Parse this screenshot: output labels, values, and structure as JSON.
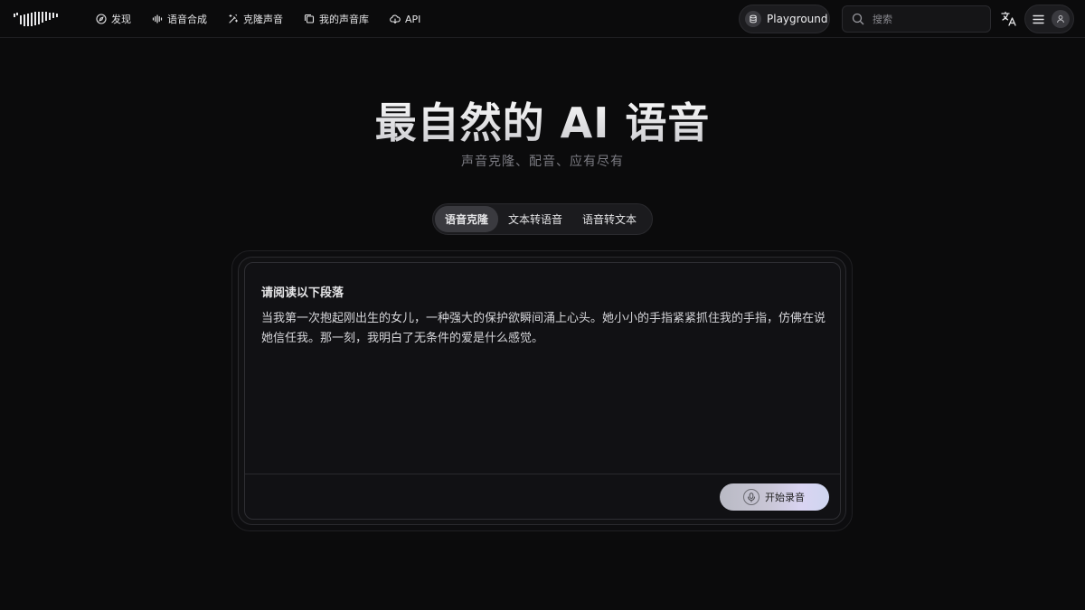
{
  "nav": {
    "items": [
      {
        "label": "发现",
        "icon": "compass-icon"
      },
      {
        "label": "语音合成",
        "icon": "waveform-icon"
      },
      {
        "label": "克隆声音",
        "icon": "magic-wand-icon"
      },
      {
        "label": "我的声音库",
        "icon": "library-icon"
      },
      {
        "label": "API",
        "icon": "cloud-icon"
      }
    ],
    "playground_label": "Playground",
    "search_placeholder": "搜索"
  },
  "hero": {
    "title": "最自然的 AI 语音",
    "subtitle": "声音克隆、配音、应有尽有"
  },
  "tabs": [
    {
      "label": "语音克隆",
      "active": true
    },
    {
      "label": "文本转语音",
      "active": false
    },
    {
      "label": "语音转文本",
      "active": false
    }
  ],
  "card": {
    "heading": "请阅读以下段落",
    "text": "当我第一次抱起刚出生的女儿，一种强大的保护欲瞬间涌上心头。她小小的手指紧紧抓住我的手指，仿佛在说她信任我。那一刻，我明白了无条件的爱是什么感觉。",
    "record_label": "开始录音"
  },
  "colors": {
    "background": "#0b0b0c",
    "active_tab": "#3a3a3f",
    "record_gradient_start": "#b9bac4",
    "record_gradient_end": "#d9d4f2"
  }
}
